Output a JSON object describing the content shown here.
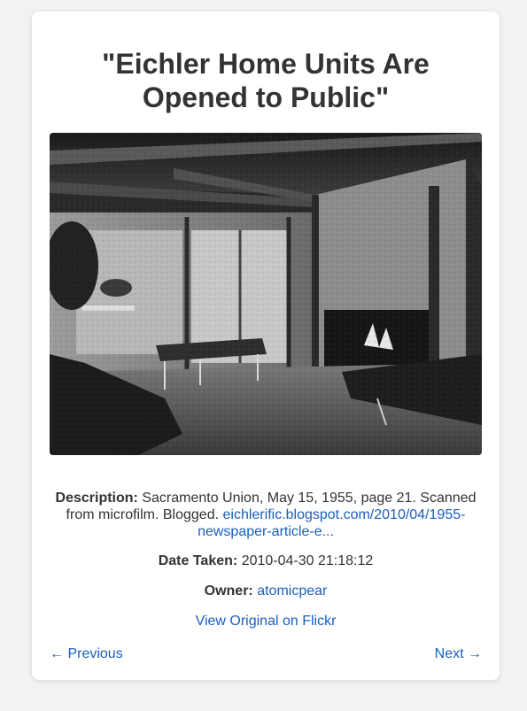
{
  "page": {
    "title": "\"Eichler Home Units Are Opened to Public\""
  },
  "photo": {
    "alt": "Eichler Home Units Are Opened to Public"
  },
  "details": {
    "description_label": "Description:",
    "description_text": "Sacramento Union, May 15, 1955, page 21. Scanned from microfilm. Blogged.",
    "description_link": "eichlerific.blogspot.com/2010/04/1955-newspaper-article-e...",
    "date_label": "Date Taken:",
    "date_value": "2010-04-30 21:18:12",
    "owner_label": "Owner:",
    "owner_value": "atomicpear",
    "flickr_link": "View Original on Flickr"
  },
  "navigation": {
    "previous": "← Previous",
    "next": "Next →"
  },
  "colors": {
    "link": "#1a5fbf",
    "text": "#333333",
    "background": "#f2f2f2",
    "card": "#ffffff"
  }
}
